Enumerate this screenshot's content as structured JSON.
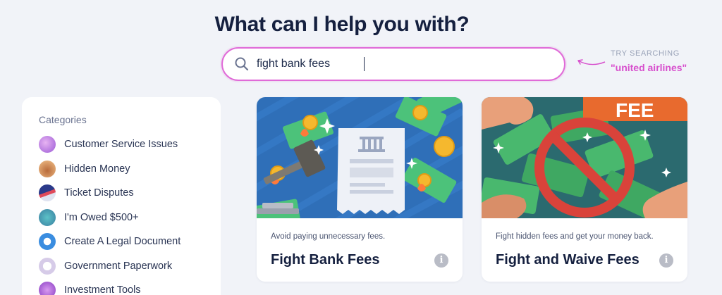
{
  "header": {
    "title": "What can I help you with?"
  },
  "search": {
    "value": "fight bank fees",
    "placeholder": ""
  },
  "suggestion": {
    "title": "TRY SEARCHING",
    "link": "\"united airlines\""
  },
  "categories": {
    "title": "Categories",
    "items": [
      {
        "label": "Customer Service Issues",
        "icon": "customer-service-icon",
        "color": "#b66be0"
      },
      {
        "label": "Hidden Money",
        "icon": "treasure-chest-icon",
        "color": "#e0905a"
      },
      {
        "label": "Ticket Disputes",
        "icon": "ticket-icon",
        "color": "#3a5bd9"
      },
      {
        "label": "I'm Owed $500+",
        "icon": "money-bag-icon",
        "color": "#4aa8b8"
      },
      {
        "label": "Create A Legal Document",
        "icon": "legal-document-icon",
        "color": "#3a8de0"
      },
      {
        "label": "Government Paperwork",
        "icon": "paperwork-icon",
        "color": "#c9b9e0"
      },
      {
        "label": "Investment Tools",
        "icon": "investment-icon",
        "color": "#a04fd0"
      }
    ]
  },
  "cards": [
    {
      "subtitle": "Avoid paying unnecessary fees.",
      "title": "Fight Bank Fees",
      "image": "bank-receipt-gavel-illustration"
    },
    {
      "subtitle": "Fight hidden fees and get your money back.",
      "title": "Fight and Waive Fees",
      "image_text": "FEE",
      "image": "no-fee-illustration"
    }
  ],
  "colors": {
    "accent": "#d74fcd",
    "background": "#f1f3f8",
    "heading": "#15203f"
  }
}
